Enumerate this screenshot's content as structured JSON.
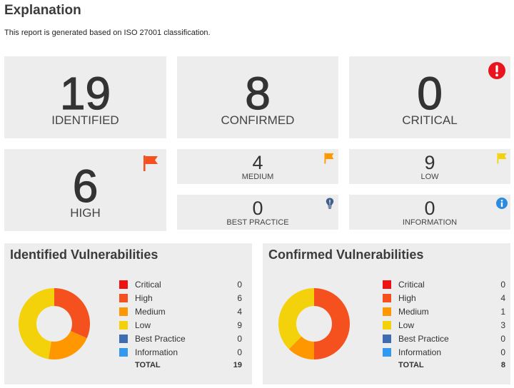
{
  "page": {
    "title": "Explanation",
    "subtitle": "This report is generated based on ISO 27001 classification."
  },
  "cards": {
    "identified": {
      "value": "19",
      "label": "IDENTIFIED"
    },
    "confirmed": {
      "value": "8",
      "label": "CONFIRMED"
    },
    "critical": {
      "value": "0",
      "label": "CRITICAL",
      "icon": "exclamation-circle-icon",
      "icon_color": "#e8141e"
    },
    "high": {
      "value": "6",
      "label": "HIGH",
      "icon": "flag-icon",
      "icon_color": "#f4511e"
    },
    "medium": {
      "value": "4",
      "label": "MEDIUM",
      "icon": "flag-icon",
      "icon_color": "#ff9800"
    },
    "low": {
      "value": "9",
      "label": "LOW",
      "icon": "flag-icon",
      "icon_color": "#f4d20b"
    },
    "best_practice": {
      "value": "0",
      "label": "BEST PRACTICE",
      "icon": "lightbulb-icon",
      "icon_color": "#3f5f8a"
    },
    "information": {
      "value": "0",
      "label": "INFORMATION",
      "icon": "info-circle-icon",
      "icon_color": "#2a8be0"
    }
  },
  "colors": {
    "Critical": "#ee1111",
    "High": "#f4511e",
    "Medium": "#ff9800",
    "Low": "#f4d20b",
    "Best Practice": "#3d6db0",
    "Information": "#3399ee"
  },
  "panels": {
    "identified": {
      "title": "Identified Vulnerabilities",
      "legend": [
        {
          "name": "Critical",
          "value": "0"
        },
        {
          "name": "High",
          "value": "6"
        },
        {
          "name": "Medium",
          "value": "4"
        },
        {
          "name": "Low",
          "value": "9"
        },
        {
          "name": "Best Practice",
          "value": "0"
        },
        {
          "name": "Information",
          "value": "0"
        }
      ],
      "total_label": "TOTAL",
      "total_value": "19"
    },
    "confirmed": {
      "title": "Confirmed Vulnerabilities",
      "legend": [
        {
          "name": "Critical",
          "value": "0"
        },
        {
          "name": "High",
          "value": "4"
        },
        {
          "name": "Medium",
          "value": "1"
        },
        {
          "name": "Low",
          "value": "3"
        },
        {
          "name": "Best Practice",
          "value": "0"
        },
        {
          "name": "Information",
          "value": "0"
        }
      ],
      "total_label": "TOTAL",
      "total_value": "8"
    }
  }
}
